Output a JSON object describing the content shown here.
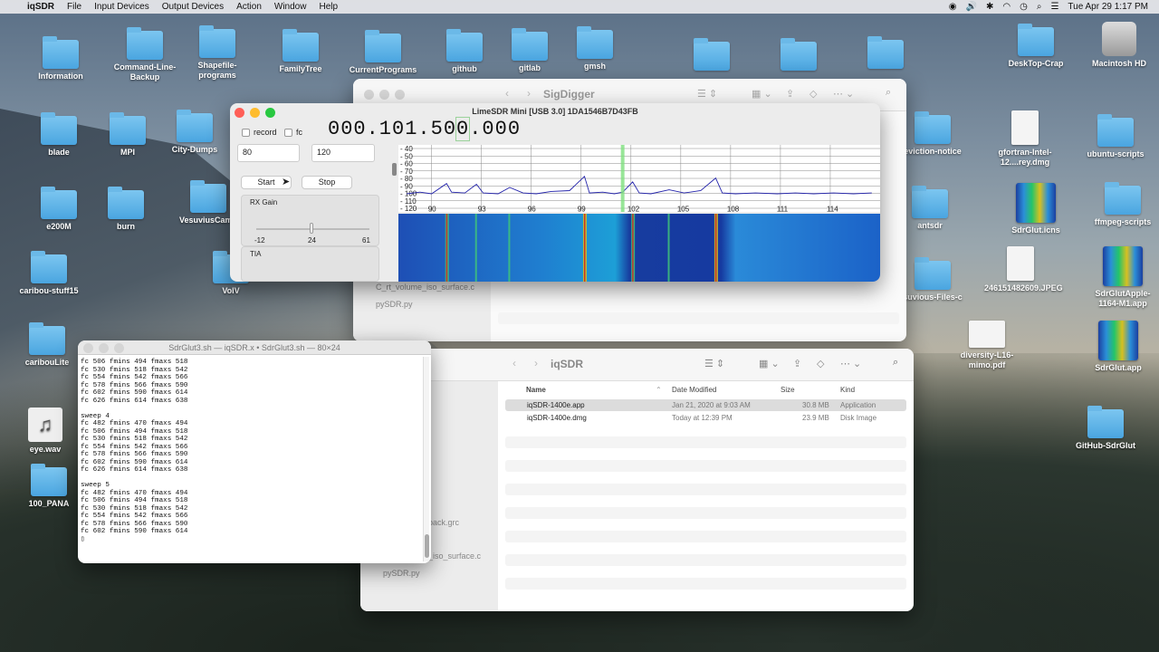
{
  "menubar": {
    "app_name": "iqSDR",
    "items": [
      "File",
      "Input Devices",
      "Output Devices",
      "Action",
      "Window",
      "Help"
    ],
    "clock": "Tue Apr 29  1:17 PM"
  },
  "desktop_icons": [
    {
      "label": "Information"
    },
    {
      "label": "Command-Line-Backup"
    },
    {
      "label": "Shapefile-programs"
    },
    {
      "label": "FamilyTree"
    },
    {
      "label": "CurrentPrograms"
    },
    {
      "label": "github"
    },
    {
      "label": "gitlab"
    },
    {
      "label": "gmsh"
    },
    {
      "label": "DeskTop-Crap"
    },
    {
      "label": "Macintosh HD"
    },
    {
      "label": "blade"
    },
    {
      "label": "MPI"
    },
    {
      "label": "City-Dumps"
    },
    {
      "label": "eviction-notice"
    },
    {
      "label": "gfortran-Intel-12....rey.dmg"
    },
    {
      "label": "ubuntu-scripts"
    },
    {
      "label": "e200M"
    },
    {
      "label": "burn"
    },
    {
      "label": "VesuviusCamp"
    },
    {
      "label": "antsdr"
    },
    {
      "label": "SdrGlut.icns"
    },
    {
      "label": "ffmpeg-scripts"
    },
    {
      "label": "caribou-stuff15"
    },
    {
      "label": "VolV"
    },
    {
      "label": "suvious-Files-c"
    },
    {
      "label": "246151482609.JPEG"
    },
    {
      "label": "SdrGlutApple-1164-M1.app"
    },
    {
      "label": "caribouLite"
    },
    {
      "label": "diversity-L16-mimo.pdf"
    },
    {
      "label": "SdrGlut.app"
    },
    {
      "label": "eye.wav"
    },
    {
      "label": "GitHub-SdrGlut"
    },
    {
      "label": "100_PANA"
    }
  ],
  "finder_back": {
    "title": "SigDigger",
    "sidebar_files": [
      "C_rt_volume_iso_surface.c",
      "pySDR.py"
    ]
  },
  "finder_front": {
    "title": "iqSDR",
    "columns": [
      "Name",
      "Date Modified",
      "Size",
      "Kind"
    ],
    "rows": [
      {
        "name": "iqSDR-1400e.app",
        "date": "Jan 21, 2020 at 9:03 AM",
        "size": "30.8 MB",
        "kind": "Application"
      },
      {
        "name": "iqSDR-1400e.dmg",
        "date": "Today at 12:39 PM",
        "size": "23.9 MB",
        "kind": "Disk Image"
      }
    ],
    "sidebar_files": [
      "back.grc",
      "_iso_surface.c",
      "pySDR.py"
    ]
  },
  "lime": {
    "title": "LimeSDR Mini [USB 3.0] 1DA1546B7D43FB",
    "record_label": "record",
    "fc_label": "fc",
    "frequency_pre": "000.101.50",
    "frequency_cursor": "0",
    "frequency_post": ".000",
    "input_left": "80",
    "input_right": "120",
    "start_label": "Start",
    "stop_label": "Stop",
    "rx_gain_label": "RX Gain",
    "gain_min": "-12",
    "gain_value": "24",
    "gain_max": "61",
    "tia_label": "TIA"
  },
  "chart_data": {
    "type": "line",
    "xlim": [
      88,
      117
    ],
    "x_ticks": [
      "90",
      "93",
      "96",
      "99",
      "102",
      "105",
      "108",
      "111",
      "114"
    ],
    "y_ticks": [
      "40",
      "50",
      "60",
      "70",
      "80",
      "90",
      "100",
      "110",
      "120"
    ],
    "ylim": [
      -120,
      -35
    ],
    "series": [
      {
        "values": [
          [
            88.5,
            -97
          ],
          [
            89.3,
            -95
          ],
          [
            90.0,
            -97
          ],
          [
            90.9,
            -84
          ],
          [
            91.2,
            -95
          ],
          [
            92.0,
            -96
          ],
          [
            92.7,
            -85
          ],
          [
            93.1,
            -96
          ],
          [
            94.0,
            -97
          ],
          [
            94.7,
            -89
          ],
          [
            95.5,
            -96
          ],
          [
            96.3,
            -97
          ],
          [
            97.2,
            -94
          ],
          [
            98.3,
            -93
          ],
          [
            99.2,
            -75
          ],
          [
            99.5,
            -96
          ],
          [
            100.3,
            -95
          ],
          [
            101.0,
            -97
          ],
          [
            101.5,
            -95
          ],
          [
            102.1,
            -82
          ],
          [
            102.5,
            -96
          ],
          [
            103.2,
            -97
          ],
          [
            104.3,
            -92
          ],
          [
            105.2,
            -96
          ],
          [
            106.2,
            -93
          ],
          [
            107.1,
            -77
          ],
          [
            107.5,
            -96
          ],
          [
            108.3,
            -97
          ],
          [
            109.5,
            -96
          ],
          [
            110.8,
            -97
          ],
          [
            111.9,
            -96
          ],
          [
            113.0,
            -97
          ],
          [
            114.2,
            -96
          ],
          [
            115.4,
            -97
          ],
          [
            116.5,
            -96
          ]
        ]
      }
    ],
    "marker_x": 101.5
  },
  "terminal": {
    "title": "SdrGlut3.sh — iqSDR.x • SdrGlut3.sh — 80×24",
    "lines": [
      "fc 506 fmins 494 fmaxs 518",
      "fc 530 fmins 518 fmaxs 542",
      "fc 554 fmins 542 fmaxs 566",
      "fc 578 fmins 566 fmaxs 590",
      "fc 602 fmins 590 fmaxs 614",
      "fc 626 fmins 614 fmaxs 638",
      "",
      "sweep 4",
      "fc 482 fmins 470 fmaxs 494",
      "fc 506 fmins 494 fmaxs 518",
      "fc 530 fmins 518 fmaxs 542",
      "fc 554 fmins 542 fmaxs 566",
      "fc 578 fmins 566 fmaxs 590",
      "fc 602 fmins 590 fmaxs 614",
      "fc 626 fmins 614 fmaxs 638",
      "",
      "sweep 5",
      "fc 482 fmins 470 fmaxs 494",
      "fc 506 fmins 494 fmaxs 518",
      "fc 530 fmins 518 fmaxs 542",
      "fc 554 fmins 542 fmaxs 566",
      "fc 578 fmins 566 fmaxs 590",
      "fc 602 fmins 590 fmaxs 614",
      "▯"
    ]
  }
}
